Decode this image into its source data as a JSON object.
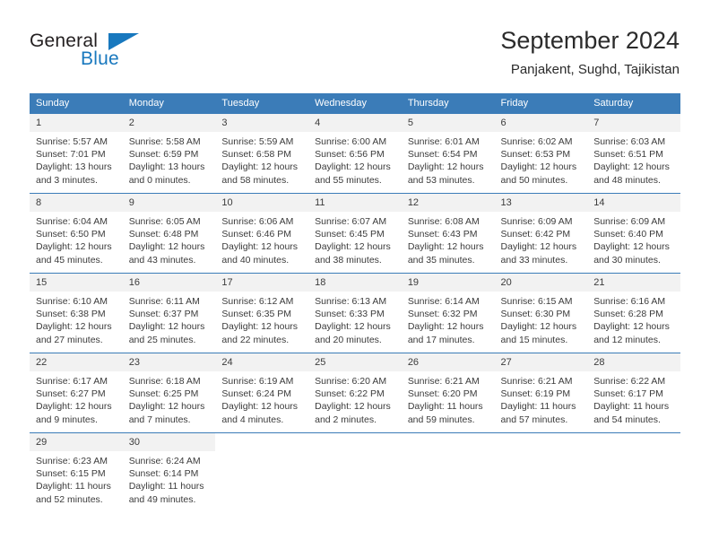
{
  "branding": {
    "logo_text_primary": "General",
    "logo_text_secondary": "Blue",
    "accent_color": "#1878be",
    "header_color": "#3b7cb8"
  },
  "header": {
    "title": "September 2024",
    "subtitle": "Panjakent, Sughd, Tajikistan"
  },
  "calendar": {
    "weekday_headers": [
      "Sunday",
      "Monday",
      "Tuesday",
      "Wednesday",
      "Thursday",
      "Friday",
      "Saturday"
    ],
    "weeks": [
      [
        {
          "day": "1",
          "sunrise": "Sunrise: 5:57 AM",
          "sunset": "Sunset: 7:01 PM",
          "daylight_line1": "Daylight: 13 hours",
          "daylight_line2": "and 3 minutes."
        },
        {
          "day": "2",
          "sunrise": "Sunrise: 5:58 AM",
          "sunset": "Sunset: 6:59 PM",
          "daylight_line1": "Daylight: 13 hours",
          "daylight_line2": "and 0 minutes."
        },
        {
          "day": "3",
          "sunrise": "Sunrise: 5:59 AM",
          "sunset": "Sunset: 6:58 PM",
          "daylight_line1": "Daylight: 12 hours",
          "daylight_line2": "and 58 minutes."
        },
        {
          "day": "4",
          "sunrise": "Sunrise: 6:00 AM",
          "sunset": "Sunset: 6:56 PM",
          "daylight_line1": "Daylight: 12 hours",
          "daylight_line2": "and 55 minutes."
        },
        {
          "day": "5",
          "sunrise": "Sunrise: 6:01 AM",
          "sunset": "Sunset: 6:54 PM",
          "daylight_line1": "Daylight: 12 hours",
          "daylight_line2": "and 53 minutes."
        },
        {
          "day": "6",
          "sunrise": "Sunrise: 6:02 AM",
          "sunset": "Sunset: 6:53 PM",
          "daylight_line1": "Daylight: 12 hours",
          "daylight_line2": "and 50 minutes."
        },
        {
          "day": "7",
          "sunrise": "Sunrise: 6:03 AM",
          "sunset": "Sunset: 6:51 PM",
          "daylight_line1": "Daylight: 12 hours",
          "daylight_line2": "and 48 minutes."
        }
      ],
      [
        {
          "day": "8",
          "sunrise": "Sunrise: 6:04 AM",
          "sunset": "Sunset: 6:50 PM",
          "daylight_line1": "Daylight: 12 hours",
          "daylight_line2": "and 45 minutes."
        },
        {
          "day": "9",
          "sunrise": "Sunrise: 6:05 AM",
          "sunset": "Sunset: 6:48 PM",
          "daylight_line1": "Daylight: 12 hours",
          "daylight_line2": "and 43 minutes."
        },
        {
          "day": "10",
          "sunrise": "Sunrise: 6:06 AM",
          "sunset": "Sunset: 6:46 PM",
          "daylight_line1": "Daylight: 12 hours",
          "daylight_line2": "and 40 minutes."
        },
        {
          "day": "11",
          "sunrise": "Sunrise: 6:07 AM",
          "sunset": "Sunset: 6:45 PM",
          "daylight_line1": "Daylight: 12 hours",
          "daylight_line2": "and 38 minutes."
        },
        {
          "day": "12",
          "sunrise": "Sunrise: 6:08 AM",
          "sunset": "Sunset: 6:43 PM",
          "daylight_line1": "Daylight: 12 hours",
          "daylight_line2": "and 35 minutes."
        },
        {
          "day": "13",
          "sunrise": "Sunrise: 6:09 AM",
          "sunset": "Sunset: 6:42 PM",
          "daylight_line1": "Daylight: 12 hours",
          "daylight_line2": "and 33 minutes."
        },
        {
          "day": "14",
          "sunrise": "Sunrise: 6:09 AM",
          "sunset": "Sunset: 6:40 PM",
          "daylight_line1": "Daylight: 12 hours",
          "daylight_line2": "and 30 minutes."
        }
      ],
      [
        {
          "day": "15",
          "sunrise": "Sunrise: 6:10 AM",
          "sunset": "Sunset: 6:38 PM",
          "daylight_line1": "Daylight: 12 hours",
          "daylight_line2": "and 27 minutes."
        },
        {
          "day": "16",
          "sunrise": "Sunrise: 6:11 AM",
          "sunset": "Sunset: 6:37 PM",
          "daylight_line1": "Daylight: 12 hours",
          "daylight_line2": "and 25 minutes."
        },
        {
          "day": "17",
          "sunrise": "Sunrise: 6:12 AM",
          "sunset": "Sunset: 6:35 PM",
          "daylight_line1": "Daylight: 12 hours",
          "daylight_line2": "and 22 minutes."
        },
        {
          "day": "18",
          "sunrise": "Sunrise: 6:13 AM",
          "sunset": "Sunset: 6:33 PM",
          "daylight_line1": "Daylight: 12 hours",
          "daylight_line2": "and 20 minutes."
        },
        {
          "day": "19",
          "sunrise": "Sunrise: 6:14 AM",
          "sunset": "Sunset: 6:32 PM",
          "daylight_line1": "Daylight: 12 hours",
          "daylight_line2": "and 17 minutes."
        },
        {
          "day": "20",
          "sunrise": "Sunrise: 6:15 AM",
          "sunset": "Sunset: 6:30 PM",
          "daylight_line1": "Daylight: 12 hours",
          "daylight_line2": "and 15 minutes."
        },
        {
          "day": "21",
          "sunrise": "Sunrise: 6:16 AM",
          "sunset": "Sunset: 6:28 PM",
          "daylight_line1": "Daylight: 12 hours",
          "daylight_line2": "and 12 minutes."
        }
      ],
      [
        {
          "day": "22",
          "sunrise": "Sunrise: 6:17 AM",
          "sunset": "Sunset: 6:27 PM",
          "daylight_line1": "Daylight: 12 hours",
          "daylight_line2": "and 9 minutes."
        },
        {
          "day": "23",
          "sunrise": "Sunrise: 6:18 AM",
          "sunset": "Sunset: 6:25 PM",
          "daylight_line1": "Daylight: 12 hours",
          "daylight_line2": "and 7 minutes."
        },
        {
          "day": "24",
          "sunrise": "Sunrise: 6:19 AM",
          "sunset": "Sunset: 6:24 PM",
          "daylight_line1": "Daylight: 12 hours",
          "daylight_line2": "and 4 minutes."
        },
        {
          "day": "25",
          "sunrise": "Sunrise: 6:20 AM",
          "sunset": "Sunset: 6:22 PM",
          "daylight_line1": "Daylight: 12 hours",
          "daylight_line2": "and 2 minutes."
        },
        {
          "day": "26",
          "sunrise": "Sunrise: 6:21 AM",
          "sunset": "Sunset: 6:20 PM",
          "daylight_line1": "Daylight: 11 hours",
          "daylight_line2": "and 59 minutes."
        },
        {
          "day": "27",
          "sunrise": "Sunrise: 6:21 AM",
          "sunset": "Sunset: 6:19 PM",
          "daylight_line1": "Daylight: 11 hours",
          "daylight_line2": "and 57 minutes."
        },
        {
          "day": "28",
          "sunrise": "Sunrise: 6:22 AM",
          "sunset": "Sunset: 6:17 PM",
          "daylight_line1": "Daylight: 11 hours",
          "daylight_line2": "and 54 minutes."
        }
      ],
      [
        {
          "day": "29",
          "sunrise": "Sunrise: 6:23 AM",
          "sunset": "Sunset: 6:15 PM",
          "daylight_line1": "Daylight: 11 hours",
          "daylight_line2": "and 52 minutes."
        },
        {
          "day": "30",
          "sunrise": "Sunrise: 6:24 AM",
          "sunset": "Sunset: 6:14 PM",
          "daylight_line1": "Daylight: 11 hours",
          "daylight_line2": "and 49 minutes."
        },
        {
          "day": "",
          "sunrise": "",
          "sunset": "",
          "daylight_line1": "",
          "daylight_line2": ""
        },
        {
          "day": "",
          "sunrise": "",
          "sunset": "",
          "daylight_line1": "",
          "daylight_line2": ""
        },
        {
          "day": "",
          "sunrise": "",
          "sunset": "",
          "daylight_line1": "",
          "daylight_line2": ""
        },
        {
          "day": "",
          "sunrise": "",
          "sunset": "",
          "daylight_line1": "",
          "daylight_line2": ""
        },
        {
          "day": "",
          "sunrise": "",
          "sunset": "",
          "daylight_line1": "",
          "daylight_line2": ""
        }
      ]
    ]
  }
}
